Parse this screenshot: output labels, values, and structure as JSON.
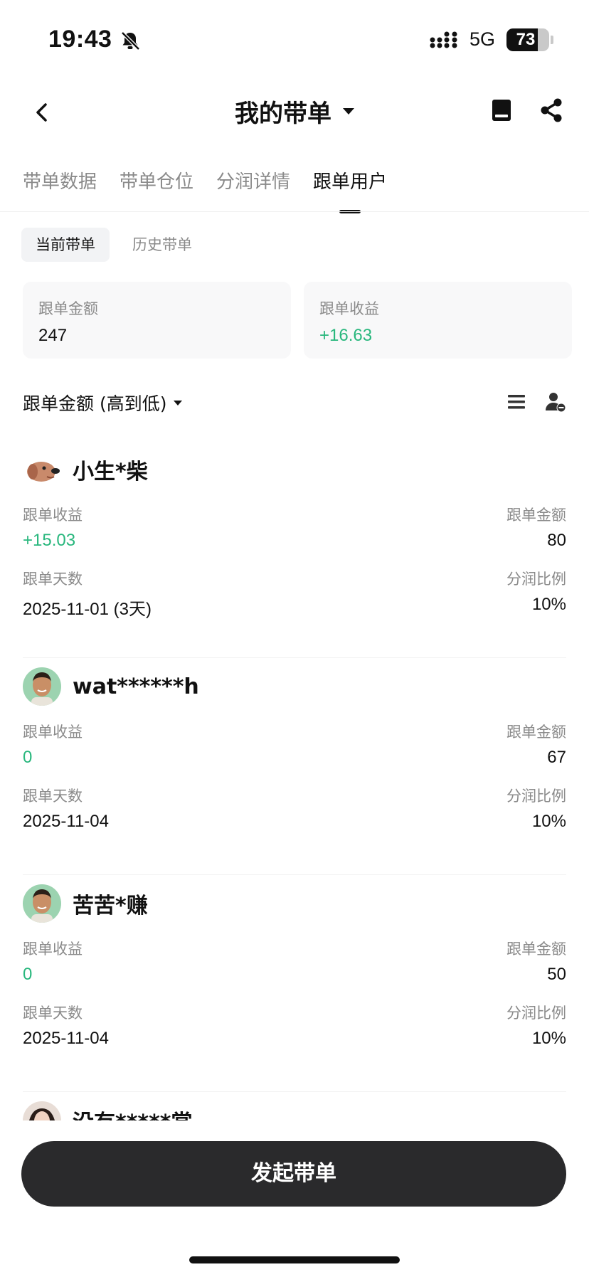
{
  "status_bar": {
    "time": "19:43",
    "network": "5G",
    "battery": "73",
    "battery_level": 0.73
  },
  "nav": {
    "title": "我的带单"
  },
  "tabs": [
    {
      "label": "带单数据",
      "active": false
    },
    {
      "label": "带单仓位",
      "active": false
    },
    {
      "label": "分润详情",
      "active": false
    },
    {
      "label": "跟单用户",
      "active": true
    }
  ],
  "segment": {
    "current": "当前带单",
    "history": "历史带单"
  },
  "summary": {
    "amount_label": "跟单金额",
    "amount_value": "247",
    "profit_label": "跟单收益",
    "profit_value": "+16.63"
  },
  "sort": {
    "label": "跟单金额 (高到低)"
  },
  "field_labels": {
    "profit": "跟单收益",
    "amount": "跟单金额",
    "days": "跟单天数",
    "share": "分润比例"
  },
  "users": [
    {
      "name": "小生*柴",
      "avatar": "dog-avatar",
      "profit": "+15.03",
      "amount": "80",
      "date": "2025-11-01 (3天)",
      "share": "10%"
    },
    {
      "name": "wat******h",
      "avatar": "man-avatar",
      "profit": "0",
      "amount": "67",
      "date": "2025-11-04",
      "share": "10%"
    },
    {
      "name": "苦苦*赚",
      "avatar": "man-avatar",
      "profit": "0",
      "amount": "50",
      "date": "2025-11-04",
      "share": "10%"
    },
    {
      "name": "没有*****赏",
      "avatar": "woman-avatar"
    }
  ],
  "cta": {
    "label": "发起带单"
  },
  "colors": {
    "positive": "#28b77d",
    "cta_background": "#2a2a2c",
    "muted_text": "#8a8a8a"
  }
}
